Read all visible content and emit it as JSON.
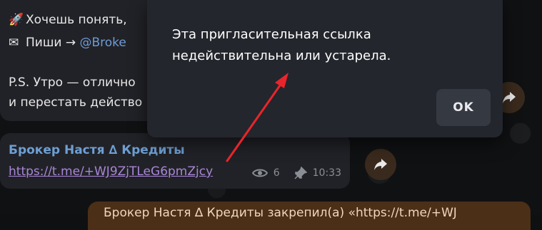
{
  "chat": {
    "message1": {
      "line1_emoji": "🚀",
      "line1_text": "Хочешь понять,",
      "line2_emoji": "✉",
      "line2_prefix": "Пиши → ",
      "line2_link": "@Broke",
      "line3_text": "P.S. Утро — отлично",
      "line4_text": "и перестать действо"
    },
    "message2": {
      "sender": "Брокер Настя ∆ Кредиты",
      "link": "https://t.me/+WJ9ZjTLeG6pmZjcy",
      "views": "6",
      "time": "10:33"
    },
    "pinned_preview": "Брокер Настя ∆ Кредиты закрепил(а) «https://t.me/+WJ"
  },
  "dialog": {
    "message": "Эта пригласительная ссылка недействительна или устарела.",
    "ok_label": "OK"
  },
  "colors": {
    "dialog_bg": "#23262c",
    "annotation_arrow": "#e8252b",
    "link": "#6f9bd6",
    "sender": "#6e9fd3"
  },
  "icons": [
    "eye-icon",
    "pin-icon",
    "share-icon",
    "rocket-emoji",
    "envelope-emoji",
    "annotation-arrow"
  ]
}
